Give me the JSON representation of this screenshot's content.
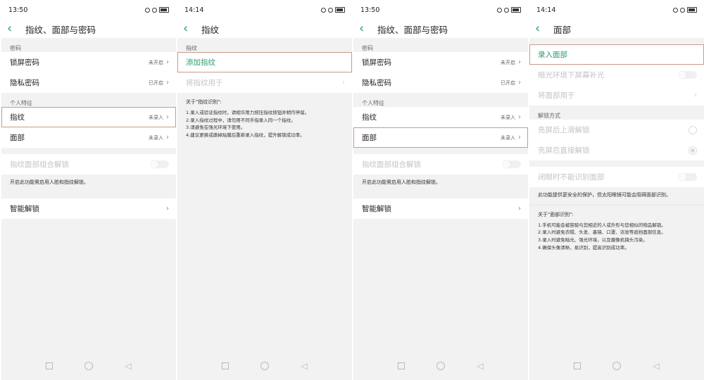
{
  "screens": [
    {
      "status_time": "13:50",
      "title": "指纹、面部与密码",
      "section1": "密码",
      "lock_pw": {
        "label": "锁屏密码",
        "value": "未开启"
      },
      "privacy_pw": {
        "label": "隐私密码",
        "value": "已开启"
      },
      "section2": "个人特征",
      "fingerprint": {
        "label": "指纹",
        "value": "未录入"
      },
      "face": {
        "label": "面部",
        "value": "未录入"
      },
      "combo_unlock": "指纹面部组合解锁",
      "combo_note": "开启此功能需启用人脸和指纹解锁。",
      "smart_unlock": "智能解锁"
    },
    {
      "status_time": "14:14",
      "title": "指纹",
      "section": "指纹",
      "add_fp": "添加指纹",
      "use_fp": "将指纹用于",
      "info_title": "关于\"指纹识别\":",
      "info_lines": [
        "1.录入或验证指纹时，请相许用力按压指纹按钮并稍作停留。",
        "2.录入指纹过程中，请勿用不同手指录入同一个指纹。",
        "3.请避免在强光环境下使用。",
        "4.建议更换或撕掉贴膜后重新录入指纹，提升解锁成功率。"
      ]
    },
    {
      "status_time": "13:50",
      "title": "指纹、面部与密码",
      "section1": "密码",
      "lock_pw": {
        "label": "锁屏密码",
        "value": "未开启"
      },
      "privacy_pw": {
        "label": "隐私密码",
        "value": "已开启"
      },
      "section2": "个人特征",
      "fingerprint": {
        "label": "指纹",
        "value": "未录入"
      },
      "face": {
        "label": "面部",
        "value": "未录入"
      },
      "combo_unlock": "指纹面部组合解锁",
      "combo_note": "开启此功能需启用人脸和指纹解锁。",
      "smart_unlock": "智能解锁"
    },
    {
      "status_time": "14:14",
      "title": "面部",
      "enroll_face": "录入面部",
      "dark_fill": "暗光环境下屏幕补光",
      "use_face": "将面部用于",
      "unlock_section": "解锁方式",
      "swipe_unlock": "亮屏后上滑解锁",
      "direct_unlock": "亮屏后直接解锁",
      "eyes_closed": "闭眼时不能识别面部",
      "eyes_note": "此功能提供更安全的保护，但太阳眼镜可能会阻碍面部识别。",
      "info_title": "关于\"面部识别\":",
      "info_lines": [
        "1.手机可能会被容貌与您相近的人或外形与您相似的物品解锁。",
        "2.录入时避免衣帽、头发、墨镜、口罩、浓妆等遮挡面部信息。",
        "3.录入时避免暗光、强光环境，以及摄像机镜头污染。",
        "4.确保头像清晰，易识别，提高识别成功率。"
      ]
    }
  ],
  "icons": {
    "back": "chevron-left-icon",
    "chevron": "chevron-right-icon",
    "nav_recent": "square-icon",
    "nav_home": "circle-icon",
    "nav_back": "triangle-back-icon"
  },
  "colors": {
    "accent": "#2a9d68",
    "highlight_border": "#c69a8a",
    "background": "#f2f2f2"
  }
}
